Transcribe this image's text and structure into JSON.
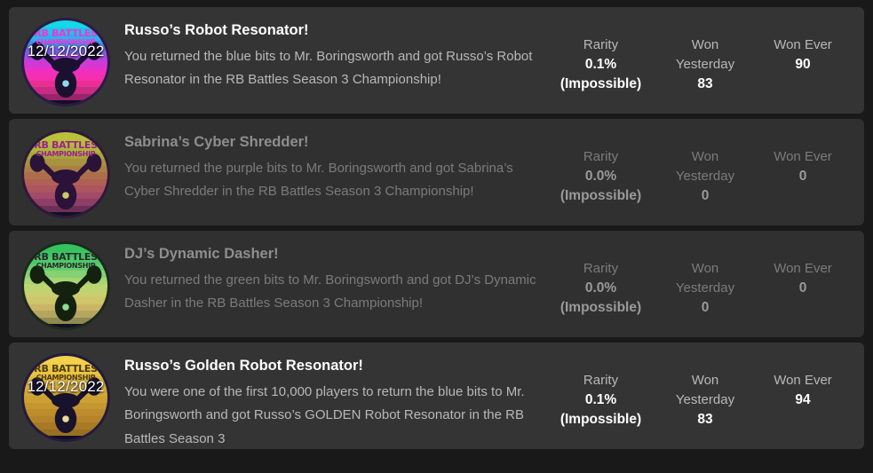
{
  "theme": {
    "page_background": "#191919",
    "card_background": "#343434",
    "card_background_dim": "#303030",
    "title_color": "#ffffff",
    "description_color": "#b8b8b8",
    "dim_text_color": "#7b7b7b"
  },
  "stat_labels": {
    "rarity": "Rarity",
    "won_yesterday_line1": "Won",
    "won_yesterday_line2": "Yesterday",
    "won_ever": "Won Ever"
  },
  "badges": [
    {
      "id": "russos-robot-resonator",
      "title": "Russo’s Robot Resonator!",
      "description": "You returned the blue bits to Mr. Boringsworth and got Russo’s Robot Resonator in the RB Battles Season 3 Championship!",
      "earned": true,
      "date_awarded": "12/12/2022",
      "icon": {
        "name": "rb-battles-robot-resonator-icon",
        "wordmark_line1": "RB BATTLES",
        "wordmark_line2": "CHAMPIONSHIP",
        "wordmark_color": "#ff2fd0",
        "ring_color": "#2a1b45",
        "stripe_colors": [
          "#14d8e8",
          "#15c9ec",
          "#2ab3ef",
          "#4a8df0",
          "#7a63ef",
          "#a94ae4",
          "#d138d6",
          "#ee2fc4",
          "#f52fae",
          "#e82f93",
          "#c92c84",
          "#98246c"
        ],
        "sun_color": "#9ef0ff",
        "emblem_color": "#1a1030"
      },
      "stats": {
        "rarity_value": "0.1%",
        "rarity_qualifier": "(Impossible)",
        "won_yesterday": "83",
        "won_ever": "90"
      }
    },
    {
      "id": "sabrinas-cyber-shredder",
      "title": "Sabrina’s Cyber Shredder!",
      "description": "You returned the purple bits to Mr. Boringsworth and got Sabrina’s Cyber Shredder in the RB Battles Season 3 Championship!",
      "earned": false,
      "date_awarded": "",
      "icon": {
        "name": "rb-battles-cyber-shredder-icon",
        "wordmark_line1": "RB BATTLES",
        "wordmark_line2": "CHAMPIONSHIP",
        "wordmark_color": "#9c1f8f",
        "ring_color": "#2e1a3a",
        "stripe_colors": [
          "#b9c13a",
          "#b6bf38",
          "#aeb63a",
          "#a9a43c",
          "#a8913f",
          "#aa7f45",
          "#ad6e4c",
          "#b06055",
          "#ad5560",
          "#a24a68",
          "#8e3f66",
          "#6d2f55"
        ],
        "sun_color": "#d8de6a",
        "emblem_color": "#2a1238"
      },
      "stats": {
        "rarity_value": "0.0%",
        "rarity_qualifier": "(Impossible)",
        "won_yesterday": "0",
        "won_ever": "0"
      }
    },
    {
      "id": "djs-dynamic-dasher",
      "title": "DJ’s Dynamic Dasher!",
      "description": "You returned the green bits to Mr. Boringsworth and got DJ’s Dynamic Dasher in the RB Battles Season 3 Championship!",
      "earned": false,
      "date_awarded": "",
      "icon": {
        "name": "rb-battles-dynamic-dasher-icon",
        "wordmark_line1": "RB BATTLES",
        "wordmark_line2": "CHAMPIONSHIP",
        "wordmark_color": "#2a2a2a",
        "ring_color": "#1b2a1c",
        "stripe_colors": [
          "#35c15e",
          "#3cc463",
          "#4ec96a",
          "#63cd6e",
          "#86d172",
          "#a6d574",
          "#bcd573",
          "#c9ce6e",
          "#cfc56a",
          "#c9b565",
          "#b5a55f",
          "#8e8a52"
        ],
        "sun_color": "#9bf0a0",
        "emblem_color": "#14210f"
      },
      "stats": {
        "rarity_value": "0.0%",
        "rarity_qualifier": "(Impossible)",
        "won_yesterday": "0",
        "won_ever": "0"
      }
    },
    {
      "id": "russos-golden-robot-resonator",
      "title": "Russo’s Golden Robot Resonator!",
      "description": "You were one of the first 10,000 players to return the blue bits to Mr. Boringsworth and got Russo’s GOLDEN Robot Resonator in the RB Battles Season 3",
      "earned": true,
      "date_awarded": "12/12/2022",
      "icon": {
        "name": "rb-battles-golden-robot-resonator-icon",
        "wordmark_line1": "RB BATTLES",
        "wordmark_line2": "CHAMPIONSHIP",
        "wordmark_color": "#4c3a12",
        "ring_color": "#251a3c",
        "stripe_colors": [
          "#f3d24b",
          "#f0cc47",
          "#e9c342",
          "#e2ba3e",
          "#dcb23c",
          "#d5a938",
          "#cda034",
          "#c59731",
          "#bd8d2d",
          "#b5842a",
          "#a87a26",
          "#977022"
        ],
        "sun_color": "#fff0a8",
        "emblem_color": "#19122c"
      },
      "stats": {
        "rarity_value": "0.1%",
        "rarity_qualifier": "(Impossible)",
        "won_yesterday": "83",
        "won_ever": "94"
      }
    }
  ]
}
